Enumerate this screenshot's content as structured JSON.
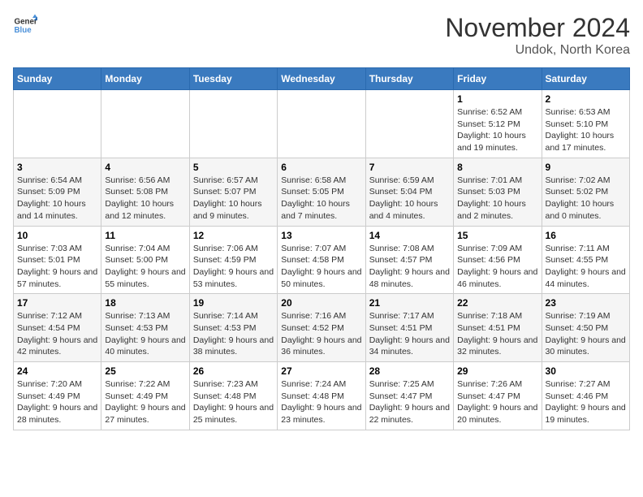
{
  "logo": {
    "line1": "General",
    "line2": "Blue"
  },
  "title": "November 2024",
  "subtitle": "Undok, North Korea",
  "days_of_week": [
    "Sunday",
    "Monday",
    "Tuesday",
    "Wednesday",
    "Thursday",
    "Friday",
    "Saturday"
  ],
  "weeks": [
    [
      {
        "day": "",
        "info": ""
      },
      {
        "day": "",
        "info": ""
      },
      {
        "day": "",
        "info": ""
      },
      {
        "day": "",
        "info": ""
      },
      {
        "day": "",
        "info": ""
      },
      {
        "day": "1",
        "info": "Sunrise: 6:52 AM\nSunset: 5:12 PM\nDaylight: 10 hours and 19 minutes."
      },
      {
        "day": "2",
        "info": "Sunrise: 6:53 AM\nSunset: 5:10 PM\nDaylight: 10 hours and 17 minutes."
      }
    ],
    [
      {
        "day": "3",
        "info": "Sunrise: 6:54 AM\nSunset: 5:09 PM\nDaylight: 10 hours and 14 minutes."
      },
      {
        "day": "4",
        "info": "Sunrise: 6:56 AM\nSunset: 5:08 PM\nDaylight: 10 hours and 12 minutes."
      },
      {
        "day": "5",
        "info": "Sunrise: 6:57 AM\nSunset: 5:07 PM\nDaylight: 10 hours and 9 minutes."
      },
      {
        "day": "6",
        "info": "Sunrise: 6:58 AM\nSunset: 5:05 PM\nDaylight: 10 hours and 7 minutes."
      },
      {
        "day": "7",
        "info": "Sunrise: 6:59 AM\nSunset: 5:04 PM\nDaylight: 10 hours and 4 minutes."
      },
      {
        "day": "8",
        "info": "Sunrise: 7:01 AM\nSunset: 5:03 PM\nDaylight: 10 hours and 2 minutes."
      },
      {
        "day": "9",
        "info": "Sunrise: 7:02 AM\nSunset: 5:02 PM\nDaylight: 10 hours and 0 minutes."
      }
    ],
    [
      {
        "day": "10",
        "info": "Sunrise: 7:03 AM\nSunset: 5:01 PM\nDaylight: 9 hours and 57 minutes."
      },
      {
        "day": "11",
        "info": "Sunrise: 7:04 AM\nSunset: 5:00 PM\nDaylight: 9 hours and 55 minutes."
      },
      {
        "day": "12",
        "info": "Sunrise: 7:06 AM\nSunset: 4:59 PM\nDaylight: 9 hours and 53 minutes."
      },
      {
        "day": "13",
        "info": "Sunrise: 7:07 AM\nSunset: 4:58 PM\nDaylight: 9 hours and 50 minutes."
      },
      {
        "day": "14",
        "info": "Sunrise: 7:08 AM\nSunset: 4:57 PM\nDaylight: 9 hours and 48 minutes."
      },
      {
        "day": "15",
        "info": "Sunrise: 7:09 AM\nSunset: 4:56 PM\nDaylight: 9 hours and 46 minutes."
      },
      {
        "day": "16",
        "info": "Sunrise: 7:11 AM\nSunset: 4:55 PM\nDaylight: 9 hours and 44 minutes."
      }
    ],
    [
      {
        "day": "17",
        "info": "Sunrise: 7:12 AM\nSunset: 4:54 PM\nDaylight: 9 hours and 42 minutes."
      },
      {
        "day": "18",
        "info": "Sunrise: 7:13 AM\nSunset: 4:53 PM\nDaylight: 9 hours and 40 minutes."
      },
      {
        "day": "19",
        "info": "Sunrise: 7:14 AM\nSunset: 4:53 PM\nDaylight: 9 hours and 38 minutes."
      },
      {
        "day": "20",
        "info": "Sunrise: 7:16 AM\nSunset: 4:52 PM\nDaylight: 9 hours and 36 minutes."
      },
      {
        "day": "21",
        "info": "Sunrise: 7:17 AM\nSunset: 4:51 PM\nDaylight: 9 hours and 34 minutes."
      },
      {
        "day": "22",
        "info": "Sunrise: 7:18 AM\nSunset: 4:51 PM\nDaylight: 9 hours and 32 minutes."
      },
      {
        "day": "23",
        "info": "Sunrise: 7:19 AM\nSunset: 4:50 PM\nDaylight: 9 hours and 30 minutes."
      }
    ],
    [
      {
        "day": "24",
        "info": "Sunrise: 7:20 AM\nSunset: 4:49 PM\nDaylight: 9 hours and 28 minutes."
      },
      {
        "day": "25",
        "info": "Sunrise: 7:22 AM\nSunset: 4:49 PM\nDaylight: 9 hours and 27 minutes."
      },
      {
        "day": "26",
        "info": "Sunrise: 7:23 AM\nSunset: 4:48 PM\nDaylight: 9 hours and 25 minutes."
      },
      {
        "day": "27",
        "info": "Sunrise: 7:24 AM\nSunset: 4:48 PM\nDaylight: 9 hours and 23 minutes."
      },
      {
        "day": "28",
        "info": "Sunrise: 7:25 AM\nSunset: 4:47 PM\nDaylight: 9 hours and 22 minutes."
      },
      {
        "day": "29",
        "info": "Sunrise: 7:26 AM\nSunset: 4:47 PM\nDaylight: 9 hours and 20 minutes."
      },
      {
        "day": "30",
        "info": "Sunrise: 7:27 AM\nSunset: 4:46 PM\nDaylight: 9 hours and 19 minutes."
      }
    ]
  ]
}
